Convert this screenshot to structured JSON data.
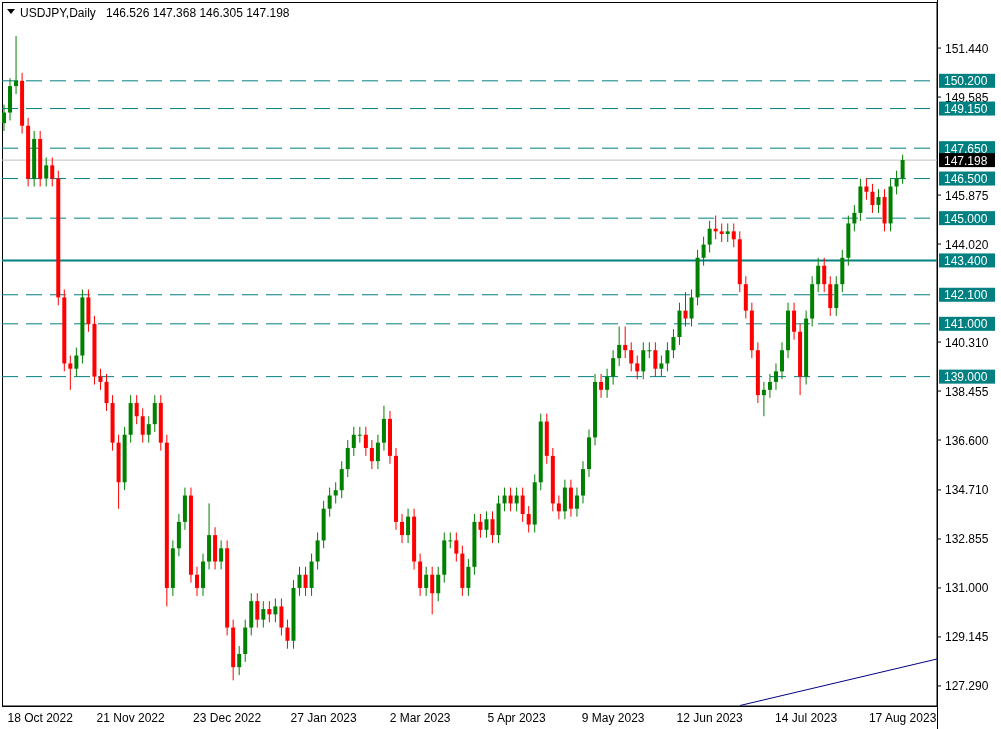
{
  "header": {
    "symbol": "USDJPY,Daily",
    "ohlc": "146.526 147.368 146.305 147.198"
  },
  "chart_data": {
    "type": "candlestick",
    "ylim": [
      126.53,
      153.26
    ],
    "categories": [
      null,
      null,
      null,
      null,
      null,
      null,
      "18 Oct 2022",
      null,
      null,
      null,
      null,
      null,
      null,
      null,
      null,
      null,
      null,
      null,
      null,
      null,
      null,
      "21 Nov 2022",
      null,
      null,
      null,
      null,
      null,
      null,
      null,
      null,
      null,
      null,
      null,
      null,
      null,
      null,
      null,
      "23 Dec 2022",
      null,
      null,
      null,
      null,
      null,
      null,
      null,
      null,
      null,
      null,
      null,
      null,
      null,
      null,
      null,
      "27 Jan 2023",
      null,
      null,
      null,
      null,
      null,
      null,
      null,
      null,
      null,
      null,
      null,
      null,
      null,
      null,
      null,
      "2 Mar 2023",
      null,
      null,
      null,
      null,
      null,
      null,
      null,
      null,
      null,
      null,
      null,
      null,
      null,
      null,
      null,
      "5 Apr 2023",
      null,
      null,
      null,
      null,
      null,
      null,
      null,
      null,
      null,
      null,
      null,
      null,
      null,
      null,
      null,
      "9 May 2023",
      null,
      null,
      null,
      null,
      null,
      null,
      null,
      null,
      null,
      null,
      null,
      null,
      null,
      null,
      null,
      "12 Jun 2023",
      null,
      null,
      null,
      null,
      null,
      null,
      null,
      null,
      null,
      null,
      null,
      null,
      null,
      null,
      null,
      "14 Jul 2023",
      null,
      null,
      null,
      null,
      null,
      null,
      null,
      null,
      null,
      null,
      null,
      null,
      null,
      null,
      null,
      "17 Aug 2023"
    ],
    "yticks": [
      {
        "value": 151.44,
        "label": "151.440"
      },
      {
        "value": 149.585,
        "label": "149.585"
      },
      {
        "value": 145.875,
        "label": "145.875"
      },
      {
        "value": 144.02,
        "label": "144.020"
      },
      {
        "value": 140.31,
        "label": "140.310"
      },
      {
        "value": 138.455,
        "label": "138.455"
      },
      {
        "value": 136.6,
        "label": "136.600"
      },
      {
        "value": 134.71,
        "label": "134.710"
      },
      {
        "value": 132.855,
        "label": "132.855"
      },
      {
        "value": 131,
        "label": "131.000"
      },
      {
        "value": 129.145,
        "label": "129.145"
      },
      {
        "value": 127.29,
        "label": "127.290"
      }
    ],
    "ohlc": [
      [
        148.6,
        149.3,
        148.3,
        149.0
      ],
      [
        149.0,
        150.3,
        148.7,
        150.0
      ],
      [
        150.0,
        151.9,
        149.7,
        150.2
      ],
      [
        150.2,
        150.5,
        148.2,
        148.5
      ],
      [
        148.5,
        148.8,
        146.2,
        146.5
      ],
      [
        146.5,
        148.3,
        146.2,
        148.0
      ],
      [
        148.0,
        148.3,
        146.2,
        146.5
      ],
      [
        146.5,
        147.3,
        146.2,
        147.0
      ],
      [
        147.0,
        147.3,
        146.2,
        146.5
      ],
      [
        146.5,
        146.8,
        141.7,
        142.0
      ],
      [
        142.0,
        142.3,
        139.2,
        139.5
      ],
      [
        139.5,
        139.8,
        138.5,
        139.3
      ],
      [
        139.3,
        140.1,
        139.0,
        139.8
      ],
      [
        139.8,
        142.3,
        139.5,
        142.0
      ],
      [
        142.0,
        142.3,
        140.7,
        141.0
      ],
      [
        141.0,
        141.3,
        138.7,
        139.0
      ],
      [
        139.0,
        139.3,
        138.5,
        138.8
      ],
      [
        138.8,
        139.1,
        137.7,
        138.0
      ],
      [
        138.0,
        138.3,
        136.2,
        136.5
      ],
      [
        136.5,
        136.8,
        134.0,
        135.0
      ],
      [
        135.0,
        137.1,
        134.7,
        136.8
      ],
      [
        136.8,
        138.3,
        136.5,
        138.0
      ],
      [
        138.0,
        138.3,
        137.2,
        137.5
      ],
      [
        137.5,
        137.8,
        136.5,
        136.8
      ],
      [
        136.8,
        137.5,
        136.5,
        137.2
      ],
      [
        137.2,
        138.3,
        136.9,
        138.0
      ],
      [
        138.0,
        138.3,
        136.2,
        136.5
      ],
      [
        136.5,
        136.8,
        130.3,
        131.0
      ],
      [
        131.0,
        132.8,
        130.7,
        132.5
      ],
      [
        132.5,
        133.8,
        132.2,
        133.5
      ],
      [
        133.5,
        134.8,
        133.2,
        134.5
      ],
      [
        134.5,
        134.8,
        131.2,
        131.5
      ],
      [
        131.5,
        131.8,
        130.7,
        131.0
      ],
      [
        131.0,
        132.3,
        130.7,
        132.0
      ],
      [
        132.0,
        134.2,
        131.7,
        133.0
      ],
      [
        133.0,
        133.3,
        131.7,
        132.0
      ],
      [
        132.0,
        132.8,
        131.7,
        132.5
      ],
      [
        132.5,
        132.8,
        129.2,
        129.5
      ],
      [
        129.5,
        129.8,
        127.5,
        128.0
      ],
      [
        128.0,
        128.8,
        127.7,
        128.5
      ],
      [
        128.5,
        129.8,
        128.2,
        129.5
      ],
      [
        129.5,
        130.8,
        129.2,
        130.5
      ],
      [
        130.5,
        130.8,
        129.5,
        129.8
      ],
      [
        129.8,
        130.5,
        129.5,
        130.2
      ],
      [
        130.2,
        130.5,
        129.7,
        130.0
      ],
      [
        130.0,
        130.6,
        129.7,
        130.3
      ],
      [
        130.3,
        130.6,
        129.2,
        129.5
      ],
      [
        129.5,
        129.8,
        128.7,
        129.0
      ],
      [
        129.0,
        131.3,
        128.7,
        131.0
      ],
      [
        131.0,
        131.8,
        130.7,
        131.5
      ],
      [
        131.5,
        131.8,
        130.7,
        131.0
      ],
      [
        131.0,
        132.3,
        130.7,
        132.0
      ],
      [
        132.0,
        133.1,
        131.7,
        132.8
      ],
      [
        132.8,
        134.3,
        132.5,
        134.0
      ],
      [
        134.0,
        134.8,
        133.7,
        134.5
      ],
      [
        134.5,
        135.0,
        134.2,
        134.7
      ],
      [
        134.7,
        135.8,
        134.4,
        135.5
      ],
      [
        135.5,
        136.6,
        135.2,
        136.3
      ],
      [
        136.3,
        137.1,
        136.0,
        136.8
      ],
      [
        136.8,
        137.1,
        136.5,
        136.8
      ],
      [
        136.8,
        137.1,
        136.0,
        136.3
      ],
      [
        136.3,
        136.6,
        135.5,
        135.8
      ],
      [
        135.8,
        136.8,
        135.5,
        136.5
      ],
      [
        136.5,
        137.9,
        136.2,
        137.4
      ],
      [
        137.4,
        137.7,
        135.7,
        136.0
      ],
      [
        136.0,
        136.3,
        133.2,
        133.5
      ],
      [
        133.5,
        133.8,
        132.7,
        133.0
      ],
      [
        133.0,
        134.0,
        132.7,
        133.7
      ],
      [
        133.7,
        134.0,
        131.7,
        132.0
      ],
      [
        132.0,
        132.3,
        130.7,
        131.0
      ],
      [
        131.0,
        131.8,
        130.7,
        131.5
      ],
      [
        131.5,
        131.8,
        130.0,
        130.8
      ],
      [
        130.8,
        131.8,
        130.5,
        131.5
      ],
      [
        131.5,
        133.1,
        131.2,
        132.8
      ],
      [
        132.8,
        133.1,
        132.5,
        132.8
      ],
      [
        132.8,
        133.1,
        132.0,
        132.3
      ],
      [
        132.3,
        132.6,
        130.7,
        131.0
      ],
      [
        131.0,
        132.1,
        130.7,
        131.8
      ],
      [
        131.8,
        133.8,
        131.5,
        133.5
      ],
      [
        133.5,
        133.8,
        132.9,
        133.2
      ],
      [
        133.2,
        133.9,
        132.9,
        133.6
      ],
      [
        133.6,
        133.9,
        132.7,
        133.0
      ],
      [
        133.0,
        134.5,
        132.7,
        134.2
      ],
      [
        134.2,
        134.8,
        133.9,
        134.5
      ],
      [
        134.5,
        134.8,
        133.9,
        134.2
      ],
      [
        134.2,
        134.8,
        133.9,
        134.5
      ],
      [
        134.5,
        134.8,
        133.5,
        133.8
      ],
      [
        133.8,
        134.1,
        133.1,
        133.4
      ],
      [
        133.4,
        135.3,
        133.1,
        135.0
      ],
      [
        135.0,
        137.6,
        134.7,
        137.3
      ],
      [
        137.3,
        137.6,
        135.7,
        136.0
      ],
      [
        136.0,
        136.3,
        133.9,
        134.2
      ],
      [
        134.2,
        134.5,
        133.6,
        133.9
      ],
      [
        133.9,
        135.1,
        133.6,
        134.8
      ],
      [
        134.8,
        135.1,
        133.7,
        134.0
      ],
      [
        134.0,
        134.8,
        133.7,
        134.5
      ],
      [
        134.5,
        135.8,
        134.2,
        135.5
      ],
      [
        135.5,
        137.0,
        135.2,
        136.7
      ],
      [
        136.7,
        139.1,
        136.4,
        138.8
      ],
      [
        138.8,
        139.1,
        138.2,
        138.5
      ],
      [
        138.5,
        139.3,
        138.2,
        139.0
      ],
      [
        139.0,
        140.0,
        138.7,
        139.7
      ],
      [
        139.7,
        140.9,
        139.4,
        140.2
      ],
      [
        140.2,
        140.9,
        139.7,
        140.0
      ],
      [
        140.0,
        140.3,
        139.2,
        139.5
      ],
      [
        139.5,
        139.8,
        138.9,
        139.2
      ],
      [
        139.2,
        140.3,
        138.9,
        140.0
      ],
      [
        140.0,
        140.3,
        139.7,
        140.0
      ],
      [
        140.0,
        140.3,
        139.0,
        139.3
      ],
      [
        139.3,
        139.8,
        139.0,
        139.5
      ],
      [
        139.5,
        140.3,
        139.2,
        140.0
      ],
      [
        140.0,
        140.8,
        139.7,
        140.5
      ],
      [
        140.5,
        141.8,
        140.2,
        141.5
      ],
      [
        141.5,
        142.2,
        140.9,
        141.2
      ],
      [
        141.2,
        142.3,
        140.9,
        142.0
      ],
      [
        142.0,
        143.8,
        141.7,
        143.5
      ],
      [
        143.5,
        144.3,
        143.2,
        144.0
      ],
      [
        144.0,
        144.9,
        143.7,
        144.6
      ],
      [
        144.6,
        145.1,
        144.2,
        144.5
      ],
      [
        144.5,
        144.8,
        144.1,
        144.4
      ],
      [
        144.4,
        144.8,
        144.1,
        144.5
      ],
      [
        144.5,
        144.8,
        143.9,
        144.2
      ],
      [
        144.2,
        144.5,
        142.2,
        142.5
      ],
      [
        142.5,
        142.8,
        141.2,
        141.5
      ],
      [
        141.5,
        141.8,
        139.7,
        140.0
      ],
      [
        140.0,
        140.3,
        138.0,
        138.3
      ],
      [
        138.3,
        138.8,
        137.5,
        138.5
      ],
      [
        138.5,
        139.1,
        138.2,
        138.8
      ],
      [
        138.8,
        139.5,
        138.5,
        139.2
      ],
      [
        139.2,
        140.3,
        138.9,
        140.0
      ],
      [
        140.0,
        141.8,
        139.7,
        141.5
      ],
      [
        141.5,
        141.8,
        140.4,
        140.7
      ],
      [
        140.7,
        141.0,
        138.3,
        139.0
      ],
      [
        139.0,
        141.5,
        138.7,
        141.2
      ],
      [
        141.2,
        142.8,
        140.9,
        142.5
      ],
      [
        142.5,
        143.5,
        142.2,
        143.2
      ],
      [
        143.2,
        143.5,
        142.2,
        142.5
      ],
      [
        142.5,
        142.8,
        141.3,
        141.6
      ],
      [
        141.6,
        142.8,
        141.3,
        142.5
      ],
      [
        142.5,
        143.8,
        142.2,
        143.5
      ],
      [
        143.5,
        145.1,
        143.2,
        144.8
      ],
      [
        144.8,
        145.5,
        144.5,
        145.2
      ],
      [
        145.2,
        146.5,
        144.9,
        146.2
      ],
      [
        146.2,
        146.5,
        145.7,
        146.0
      ],
      [
        146.0,
        146.3,
        145.2,
        145.5
      ],
      [
        145.5,
        146.1,
        145.2,
        145.8
      ],
      [
        145.8,
        146.1,
        144.5,
        144.8
      ],
      [
        144.8,
        146.5,
        144.5,
        146.2
      ],
      [
        146.2,
        146.8,
        145.9,
        146.5
      ],
      [
        146.5,
        147.4,
        146.3,
        147.2
      ]
    ],
    "ref_lines": [
      {
        "axis": "y",
        "color": "#008080",
        "value": 150.2,
        "label": "150.200"
      },
      {
        "axis": "y",
        "color": "#008080",
        "value": 149.15,
        "label": "149.150"
      },
      {
        "axis": "y",
        "color": "#008080",
        "value": 147.65,
        "label": "147.650"
      },
      {
        "axis": "y",
        "color": "#c0c0c0",
        "value": 147.198,
        "label": "147.198"
      },
      {
        "axis": "y",
        "color": "#008080",
        "value": 146.5,
        "label": "146.500"
      },
      {
        "axis": "y",
        "color": "#008080",
        "value": 145.0,
        "label": "145.000"
      },
      {
        "axis": "y",
        "color": "#008080",
        "value": 143.4,
        "label": "143.400"
      },
      {
        "axis": "y",
        "color": "#008080",
        "value": 142.1,
        "label": "142.100"
      },
      {
        "axis": "y",
        "color": "#008080",
        "value": 141.0,
        "label": "141.000"
      },
      {
        "axis": "y",
        "color": "#008080",
        "value": 139.0,
        "label": "139.000"
      }
    ]
  }
}
